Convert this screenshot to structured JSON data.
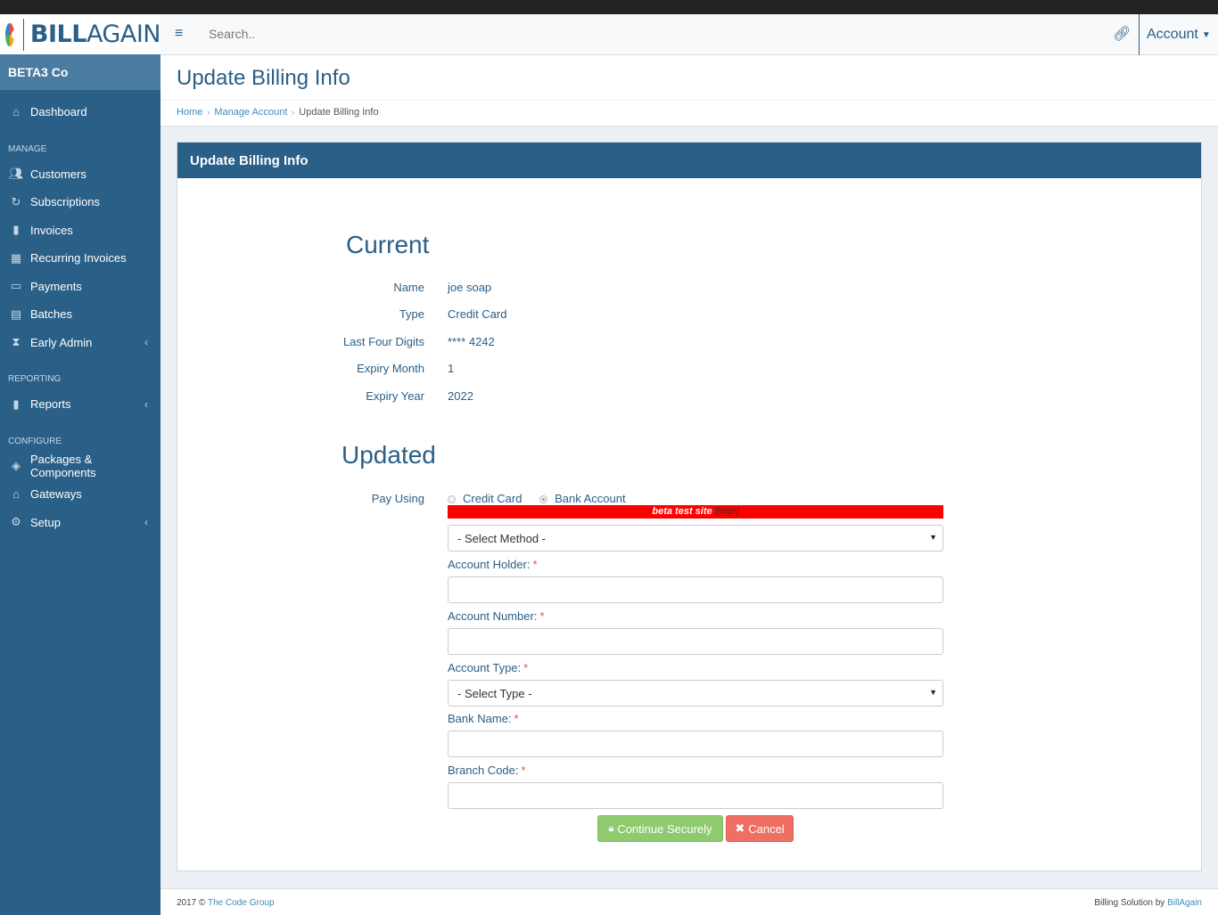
{
  "brand": {
    "name_bold": "BILL",
    "name_light": "AGAIN",
    "company": "BETA3 Co"
  },
  "header": {
    "search_placeholder": "Search..",
    "account_label": "Account"
  },
  "sidebar": {
    "dashboard": "Dashboard",
    "sections": {
      "manage": "MANAGE",
      "reporting": "REPORTING",
      "configure": "CONFIGURE"
    },
    "manage_items": [
      {
        "label": "Customers",
        "icon": "users-icon"
      },
      {
        "label": "Subscriptions",
        "icon": "refresh-icon"
      },
      {
        "label": "Invoices",
        "icon": "file-icon"
      },
      {
        "label": "Recurring Invoices",
        "icon": "calendar-icon"
      },
      {
        "label": "Payments",
        "icon": "money-icon"
      },
      {
        "label": "Batches",
        "icon": "table-icon"
      },
      {
        "label": "Early Admin",
        "icon": "hourglass-icon"
      }
    ],
    "reporting_items": [
      {
        "label": "Reports",
        "icon": "report-icon"
      }
    ],
    "configure_items": [
      {
        "label": "Packages & Components",
        "icon": "tags-icon"
      },
      {
        "label": "Gateways",
        "icon": "bank-icon"
      },
      {
        "label": "Setup",
        "icon": "gear-icon"
      }
    ]
  },
  "page": {
    "title": "Update Billing Info",
    "breadcrumb": [
      "Home",
      "Manage Account",
      "Update Billing Info"
    ],
    "panel_title": "Update Billing Info"
  },
  "current": {
    "title": "Current",
    "rows": [
      {
        "label": "Name",
        "value": "joe soap"
      },
      {
        "label": "Type",
        "value": "Credit Card"
      },
      {
        "label": "Last Four Digits",
        "value": "**** 4242"
      },
      {
        "label": "Expiry Month",
        "value": "1"
      },
      {
        "label": "Expiry Year",
        "value": "2022"
      }
    ]
  },
  "updated": {
    "title": "Updated",
    "pay_using_label": "Pay Using",
    "options": [
      "Credit Card",
      "Bank Account"
    ],
    "selected_option": "Bank Account",
    "beta_text": "beta test site",
    "beta_hide": "[hide]",
    "method_select": "- Select Method -",
    "account_holder": "Account Holder:",
    "account_number": "Account Number:",
    "account_type": "Account Type:",
    "type_select": "- Select Type -",
    "bank_name": "Bank Name:",
    "branch_code": "Branch Code:",
    "required_mark": "*",
    "continue_label": "Continue Securely",
    "cancel_label": "Cancel"
  },
  "footer": {
    "left_prefix": "2017 ©",
    "left_link": "The Code Group",
    "right_prefix": "Billing Solution by",
    "right_link": "BillAgain"
  },
  "colors": {
    "primary": "#2a5f87",
    "success": "#8fca6f",
    "danger": "#ef6f64",
    "beta": "#ff0000"
  }
}
